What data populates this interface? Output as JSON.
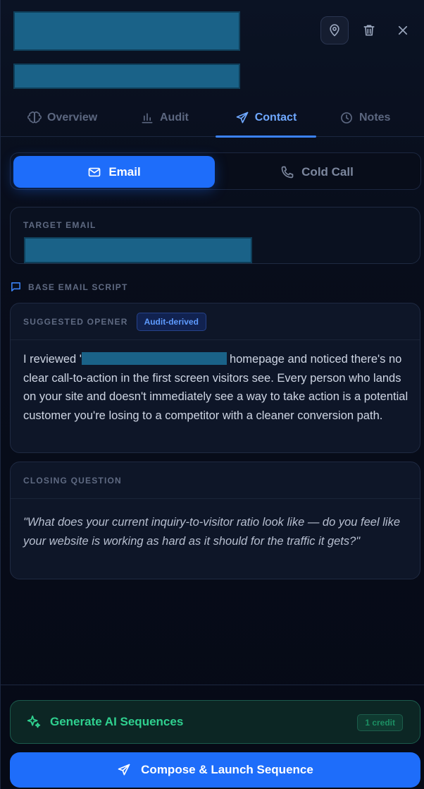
{
  "tabs": [
    {
      "label": "Overview",
      "icon": "brain-icon"
    },
    {
      "label": "Audit",
      "icon": "bar-chart-icon"
    },
    {
      "label": "Contact",
      "icon": "send-icon",
      "active": true
    },
    {
      "label": "Notes",
      "icon": "clock-icon"
    }
  ],
  "channel": {
    "email_label": "Email",
    "call_label": "Cold Call",
    "selected": "Email"
  },
  "target": {
    "label": "TARGET EMAIL"
  },
  "script": {
    "section_label": "BASE EMAIL SCRIPT",
    "opener": {
      "label": "SUGGESTED OPENER",
      "badge": "Audit-derived",
      "text_before": "I reviewed '",
      "text_after": "homepage and noticed there's no clear call-to-action in the first screen visitors see. Every person who lands on your site and doesn't immediately see a way to take action is a potential customer you're losing to a competitor with a cleaner conversion path."
    },
    "closing": {
      "label": "CLOSING QUESTION",
      "text": "\"What does your current inquiry-to-visitor ratio look like — do you feel like your website is working as hard as it should for the traffic it gets?\""
    }
  },
  "actions": {
    "generate_label": "Generate AI Sequences",
    "credit_label": "1 credit",
    "launch_label": "Compose & Launch Sequence"
  },
  "colors": {
    "accent": "#1e6dfa",
    "active_tab": "#6fa8ff",
    "ai_green": "#2fd08f",
    "background": "#070b17"
  }
}
